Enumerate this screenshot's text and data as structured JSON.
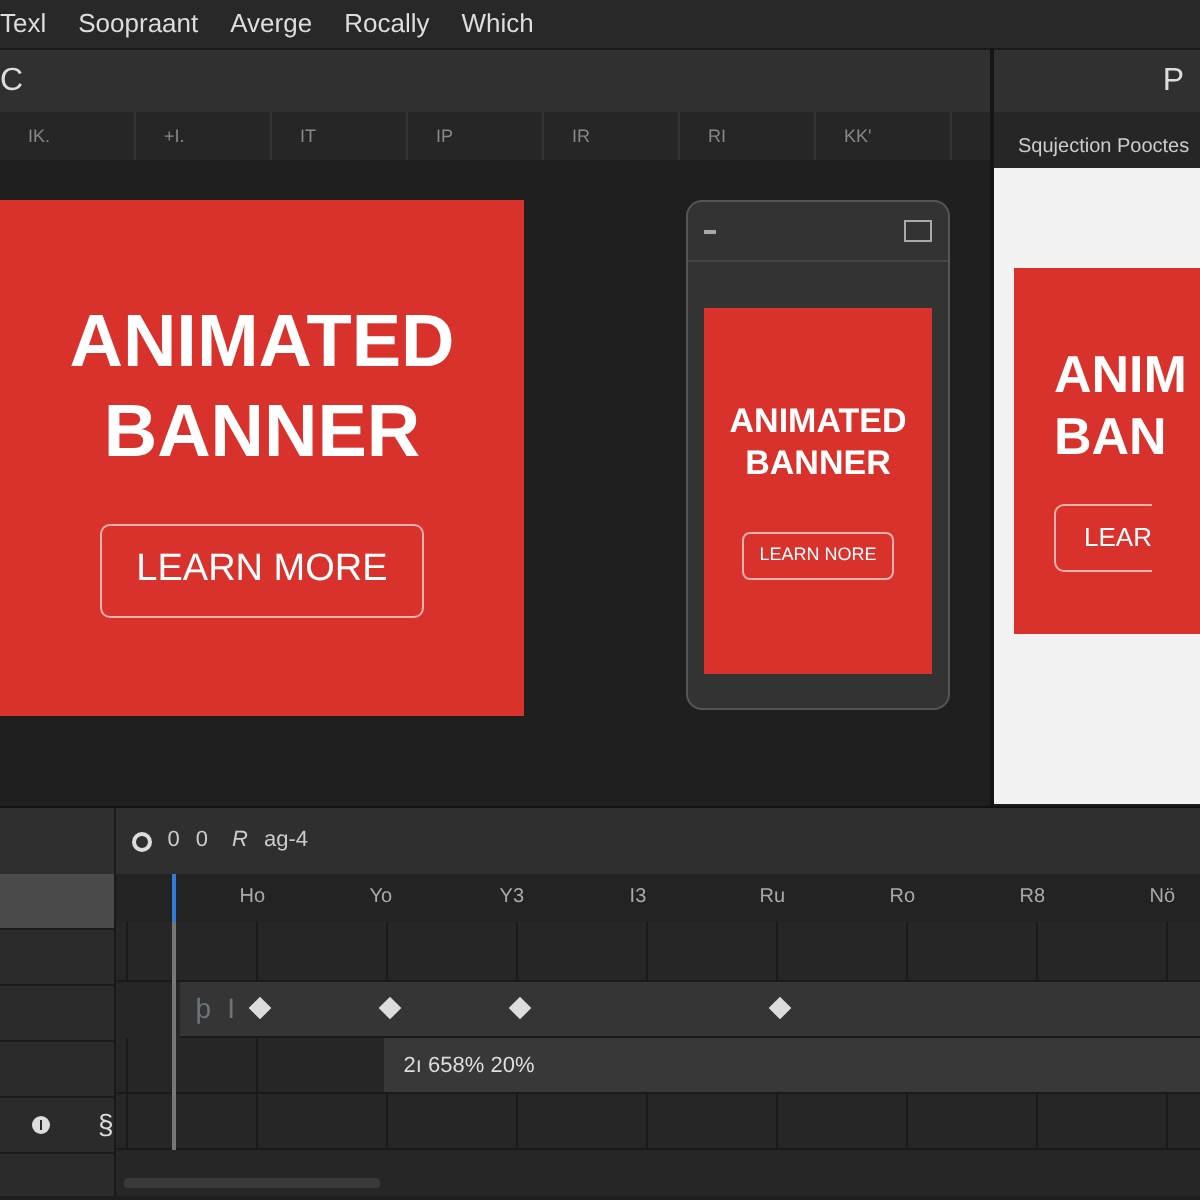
{
  "menu": [
    "Texl",
    "Soopraant",
    "Averge",
    "Rocally",
    "Which"
  ],
  "toolbar": {
    "left_label": "C",
    "right_label": "P"
  },
  "ruler": [
    "IK.",
    "+I.",
    "IT",
    "IP",
    "IR",
    "RI",
    "KK'"
  ],
  "main_banner": {
    "title": "ANIMATED BANNER",
    "button": "LEARN MORE"
  },
  "phone_preview": {
    "title": "ANIMATED BANNER",
    "button": "LEARN NORE"
  },
  "side_panel": {
    "title": "Squjection Pooctes",
    "banner_lines": [
      "ANIM",
      "BAN"
    ],
    "button": "LEAR"
  },
  "timeline": {
    "toolbar_labels": [
      "0",
      "0",
      "R",
      "ag-4"
    ],
    "ruler": [
      "Ho",
      "Yo",
      "Y3",
      "I3",
      "Ru",
      "Ro",
      "R8",
      "Nö"
    ],
    "keyframe_track": {
      "labels": [
        "þ",
        "I"
      ],
      "keyframes": [
        {
          "kind": "diamond"
        },
        {
          "kind": "diamond"
        },
        {
          "kind": "diamond"
        },
        {
          "kind": "diamond"
        }
      ]
    },
    "value_bar": "2ı 658% 20%",
    "layer_rows": [
      {
        "selected": true
      },
      {
        "selected": false
      },
      {
        "selected": false
      },
      {
        "selected": false
      }
    ],
    "layer_labels": [
      "§"
    ]
  }
}
